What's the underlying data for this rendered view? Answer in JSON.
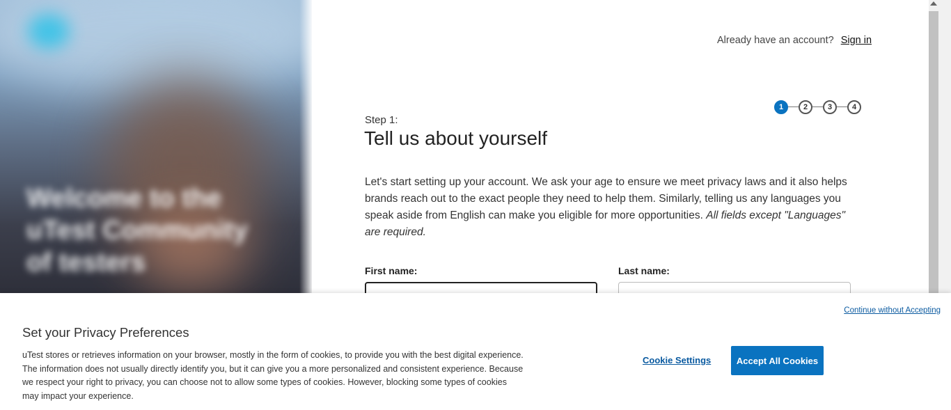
{
  "header": {
    "account_prompt": "Already have an account?",
    "sign_in_label": "Sign in"
  },
  "hero": {
    "blurred_headline": "Welcome to the uTest Community of testers"
  },
  "stepper": {
    "steps": [
      "1",
      "2",
      "3",
      "4"
    ],
    "active_step": 1,
    "active_color": "#0a73c0"
  },
  "form": {
    "step_label": "Step 1:",
    "title": "Tell us about yourself",
    "intro_text": "Let's start setting up your account. We ask your age to ensure we meet privacy laws and it also helps brands reach out to the exact people they need to help them. Similarly, telling us any languages you speak aside from English can make you eligible for more opportunities. ",
    "intro_emphasis": "All fields except \"Languages\" are required.",
    "first_name_label": "First name:",
    "first_name_value": "",
    "last_name_label": "Last name:",
    "last_name_value": ""
  },
  "cookie_banner": {
    "continue_label": "Continue without Accepting",
    "title": "Set your Privacy Preferences",
    "body": "uTest stores or retrieves information on your browser, mostly in the form of cookies, to provide you with the best digital experience. The information does not usually directly identify you, but it can give you a more personalized and consistent experience. Because we respect your right to privacy, you can choose not to allow some types of cookies. However, blocking some types of cookies may impact your experience.",
    "settings_label": "Cookie Settings",
    "accept_label": "Accept All Cookies",
    "accent_color": "#0a73c0"
  }
}
